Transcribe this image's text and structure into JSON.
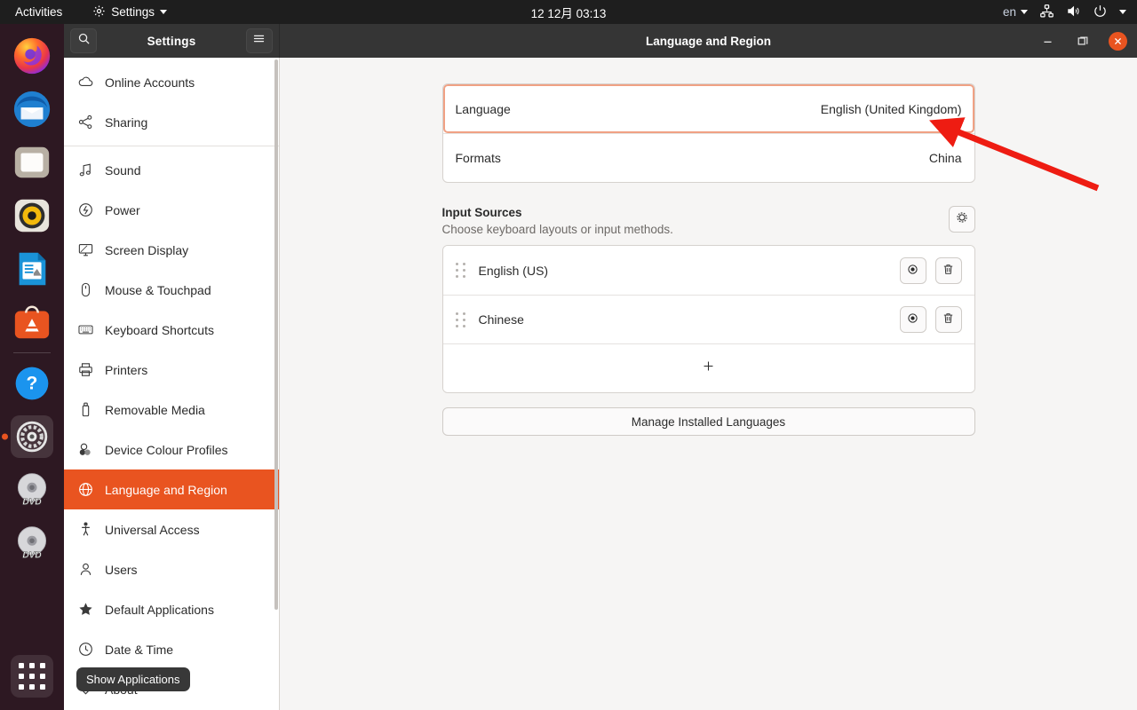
{
  "topbar": {
    "activities": "Activities",
    "app_menu": "Settings",
    "app_menu_icon": "gear-icon",
    "clock": "12 12月  03:13",
    "keyboard_layout": "en",
    "icons": [
      "network-icon",
      "volume-icon",
      "power-icon",
      "chevron-down-icon"
    ]
  },
  "dock": {
    "items": [
      {
        "name": "firefox",
        "label": "Firefox"
      },
      {
        "name": "thunderbird",
        "label": "Thunderbird Mail"
      },
      {
        "name": "files",
        "label": "Files"
      },
      {
        "name": "rhythmbox",
        "label": "Rhythmbox"
      },
      {
        "name": "libreoffice",
        "label": "LibreOffice Writer"
      },
      {
        "name": "ubuntu-software",
        "label": "Ubuntu Software"
      },
      {
        "name": "help",
        "label": "Help"
      },
      {
        "name": "settings",
        "label": "Settings",
        "running": true
      },
      {
        "name": "dvd-1",
        "label": "DVD"
      },
      {
        "name": "dvd-2",
        "label": "DVD"
      }
    ],
    "show_applications": "Show Applications"
  },
  "window": {
    "sidebar_title": "Settings",
    "title": "Language and Region",
    "search_icon": "search-icon",
    "menu_icon": "hamburger-menu-icon",
    "controls": {
      "minimize": "–",
      "maximize": "❐",
      "close": "×"
    }
  },
  "sidebar": {
    "items": [
      {
        "label": "Online Accounts",
        "icon": "cloud-icon",
        "active": false
      },
      {
        "label": "Sharing",
        "icon": "share-icon",
        "active": false,
        "separator_after": true
      },
      {
        "label": "Sound",
        "icon": "music-note-icon",
        "active": false
      },
      {
        "label": "Power",
        "icon": "power-icon",
        "active": false
      },
      {
        "label": "Screen Display",
        "icon": "monitor-icon",
        "active": false
      },
      {
        "label": "Mouse & Touchpad",
        "icon": "mouse-icon",
        "active": false
      },
      {
        "label": "Keyboard Shortcuts",
        "icon": "keyboard-icon",
        "active": false
      },
      {
        "label": "Printers",
        "icon": "printer-icon",
        "active": false
      },
      {
        "label": "Removable Media",
        "icon": "usb-drive-icon",
        "active": false
      },
      {
        "label": "Device Colour Profiles",
        "icon": "colour-profile-icon",
        "active": false
      },
      {
        "label": "Language and Region",
        "icon": "globe-icon",
        "active": true
      },
      {
        "label": "Universal Access",
        "icon": "accessibility-icon",
        "active": false
      },
      {
        "label": "Users",
        "icon": "user-icon",
        "active": false
      },
      {
        "label": "Default Applications",
        "icon": "star-icon",
        "active": false
      },
      {
        "label": "Date & Time",
        "icon": "clock-icon",
        "active": false
      },
      {
        "label": "About",
        "icon": "info-icon",
        "active": false
      }
    ]
  },
  "main": {
    "rows": [
      {
        "label": "Language",
        "value": "English (United Kingdom)",
        "focused": true
      },
      {
        "label": "Formats",
        "value": "China",
        "focused": false
      }
    ],
    "input_sources": {
      "title": "Input Sources",
      "subtitle": "Choose keyboard layouts or input methods.",
      "settings_icon": "gear-icon",
      "items": [
        {
          "name": "English (US)",
          "preview_icon": "eye-icon",
          "delete_icon": "trash-icon"
        },
        {
          "name": "Chinese",
          "preview_icon": "eye-icon",
          "delete_icon": "trash-icon"
        }
      ],
      "add_label": "+"
    },
    "manage_button": "Manage Installed Languages"
  },
  "annotation": {
    "type": "arrow",
    "color": "#ee1c12",
    "points_to": "language-row-value"
  },
  "colors": {
    "ubuntu_orange": "#e95420",
    "focus_outline": "#f0a184",
    "panel_bg": "#f6f5f4",
    "topbar_bg": "#1e1e1e",
    "titlebar_bg": "#353535"
  }
}
